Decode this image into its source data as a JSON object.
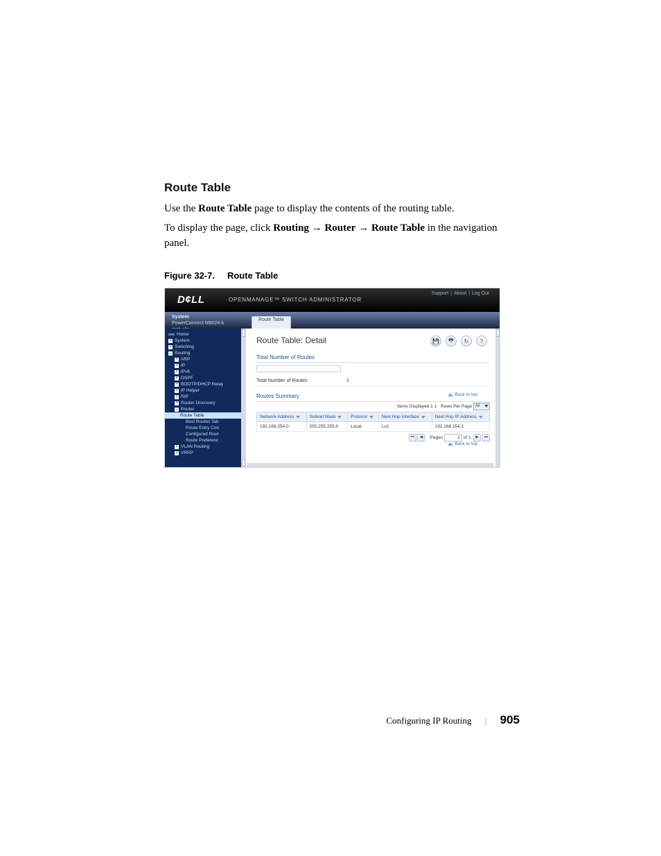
{
  "heading": "Route Table",
  "intro_pre": "Use the ",
  "intro_bold": "Route Table",
  "intro_post": " page to display the contents of the routing table.",
  "path_pre": "To display the page, click ",
  "path_b1": "Routing",
  "path_b2": "Router",
  "path_b3": "Route Table",
  "path_post": " in the navigation panel.",
  "arrow": "→",
  "fig_label": "Figure 32-7.",
  "fig_title": "Route Table",
  "shot": {
    "brand": "D¢LL",
    "suite": "OPENMANAGE™ SWITCH ADMINISTRATOR",
    "top_links": [
      "Support",
      "About",
      "Log Out"
    ],
    "sys_title": "System",
    "sys_model": "PowerConnect M8024-k",
    "sys_user": "root, r/w",
    "crumb": "Route Table",
    "nav": [
      {
        "t": "Home",
        "cls": "",
        "ic": "bar"
      },
      {
        "t": "System",
        "cls": "",
        "ic": "box"
      },
      {
        "t": "Switching",
        "cls": "",
        "ic": "box"
      },
      {
        "t": "Routing",
        "cls": "",
        "ic": "box-"
      },
      {
        "t": "ARP",
        "cls": "ind1",
        "ic": "box"
      },
      {
        "t": "IP",
        "cls": "ind1",
        "ic": "box"
      },
      {
        "t": "IPv6",
        "cls": "ind1",
        "ic": "box"
      },
      {
        "t": "OSPF",
        "cls": "ind1",
        "ic": "box"
      },
      {
        "t": "BOOTP/DHCP Relay",
        "cls": "ind1",
        "ic": "box"
      },
      {
        "t": "IP Helper",
        "cls": "ind1",
        "ic": "box"
      },
      {
        "t": "RIP",
        "cls": "ind1",
        "ic": "box"
      },
      {
        "t": "Router Discovery",
        "cls": "ind1",
        "ic": "box"
      },
      {
        "t": "Router",
        "cls": "ind1",
        "ic": "box-"
      },
      {
        "t": "Route Table",
        "cls": "ind2 sel",
        "ic": ""
      },
      {
        "t": "Best Routes Tab",
        "cls": "ind3",
        "ic": ""
      },
      {
        "t": "Route Entry Con",
        "cls": "ind3",
        "ic": ""
      },
      {
        "t": "Configured Rout",
        "cls": "ind3",
        "ic": ""
      },
      {
        "t": "Route Preferenc",
        "cls": "ind3",
        "ic": ""
      },
      {
        "t": "VLAN Routing",
        "cls": "ind1",
        "ic": "box"
      },
      {
        "t": "VRRP",
        "cls": "ind1",
        "ic": "box"
      }
    ],
    "detail_title": "Route Table: Detail",
    "icons": {
      "save": "💾",
      "print": "🖶",
      "refresh": "↻",
      "help": "?"
    },
    "sec1": "Total Number of Routes",
    "kv_label": "Total Number of Routes",
    "kv_value": "1",
    "sec2": "Routes Summary",
    "back": "Back to top",
    "items_disp": "Items Displayed 1-1",
    "rows_per": "Rows Per Page",
    "rows_sel": "All",
    "cols": [
      "Network Address",
      "Subnet Mask",
      "Protocol",
      "Next Hop Interface",
      "Next Hop IP Address"
    ],
    "row": [
      "192.168.254.0",
      "255.255.255.0",
      "Local",
      "Lo1",
      "192.168.254.1"
    ],
    "pager": {
      "first": "⏮",
      "prev": "◀",
      "label": "Pages",
      "val": "1",
      "of": "of 1",
      "next": "▶",
      "last": "⏭"
    }
  },
  "footer_chapter": "Configuring IP Routing",
  "footer_page": "905"
}
